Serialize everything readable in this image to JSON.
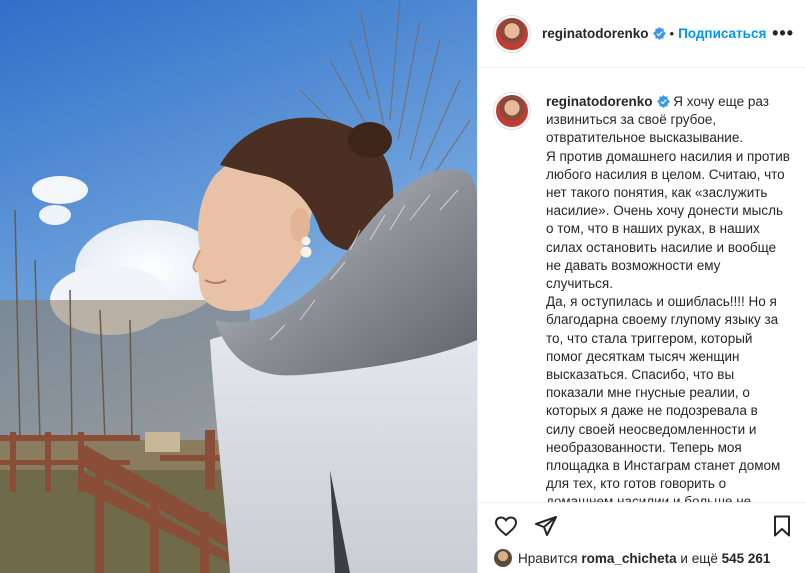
{
  "header": {
    "username": "reginatodorenko",
    "separator": "•",
    "follow_label": "Подписаться",
    "more_label": "•••"
  },
  "caption": {
    "username": "reginatodorenko",
    "text": "Я хочу еще раз извиниться за своё грубое, отвратительное высказывание.\nЯ против домашнего насилия и против любого насилия в целом. Считаю, что нет такого понятия, как «заслужить насилие». Очень хочу донести мысль о том, что в наших руках, в наших силах остановить насилие и вообще не давать возможности ему случиться.\nДа, я оступилась и ошиблась!!!! Но я благодарна своему глупому языку за то, что стала триггером, который помог десяткам тысяч женщин высказаться. Спасибо, что вы показали мне гнусные реалии, о которых я даже не подозревала в силу своей неосведомленности и необразованности. Теперь моя площадка в Инстаграм станет домом для тех, кто готов говорить о домашнем насилии и больше не"
  },
  "likes": {
    "prefix": "Нравится",
    "user": "roma_chicheta",
    "and_more": "и ещё",
    "count": "545 261"
  },
  "icons": {
    "verified": "verified-badge-icon",
    "like": "heart-icon",
    "share": "paper-plane-icon",
    "save": "bookmark-icon",
    "more": "more-dots-icon"
  },
  "colors": {
    "accent": "#0095f6",
    "verified": "#3897f0",
    "border": "#efefef",
    "text": "#262626"
  }
}
